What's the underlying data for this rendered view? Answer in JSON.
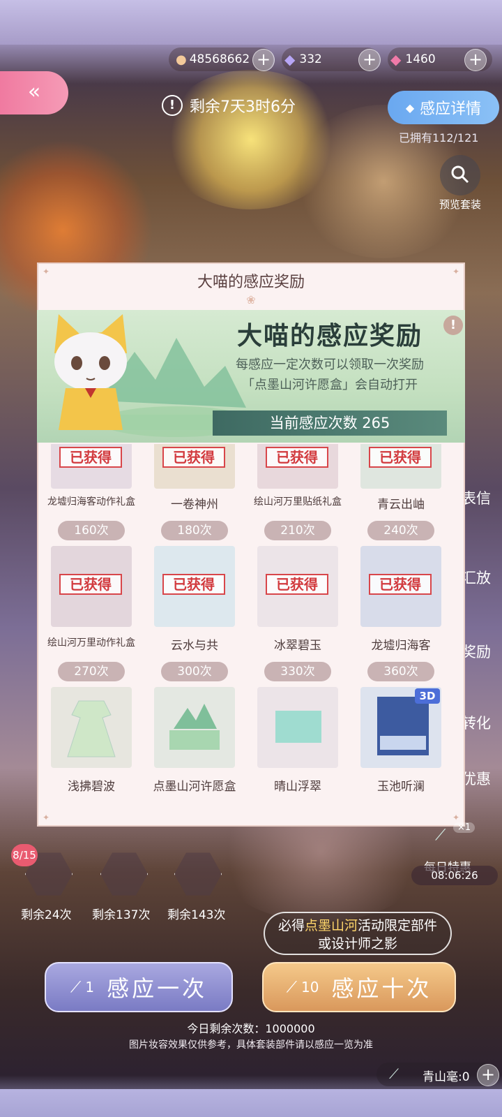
{
  "currency": {
    "coins": "48568662",
    "diamonds": "332",
    "pink_diamonds": "1460",
    "plus": "+"
  },
  "header": {
    "back_icon": "«",
    "timer_icon": "!",
    "timer": "剩余7天3时6分",
    "detail_button": "感应详情",
    "owned": "已拥有112/121",
    "preview_label": "预览套装"
  },
  "side_tabs": [
    "表信",
    "汇放",
    "奖励",
    "转化",
    "优惠"
  ],
  "modal": {
    "title": "大喵的感应奖励",
    "banner_title": "大喵的感应奖励",
    "banner_info": "!",
    "banner_desc_1": "每感应一定次数可以领取一次奖励",
    "banner_desc_2": "「点墨山河许愿盒」会自动打开",
    "banner_count": "当前感应次数 265",
    "obtained_label": "已获得",
    "rows": [
      {
        "items": [
          {
            "name": "龙墟归海客动作礼盒",
            "obtained": true
          },
          {
            "name": "一卷神州",
            "obtained": true
          },
          {
            "name": "绘山河万里贴纸礼盒",
            "obtained": true
          },
          {
            "name": "青云出岫",
            "obtained": true
          }
        ]
      },
      {
        "items": [
          {
            "count": "160次",
            "name": "绘山河万里动作礼盒",
            "obtained": true
          },
          {
            "count": "180次",
            "name": "云水与共",
            "obtained": true
          },
          {
            "count": "210次",
            "name": "冰翠碧玉",
            "obtained": true
          },
          {
            "count": "240次",
            "name": "龙墟归海客",
            "obtained": true
          }
        ]
      },
      {
        "items": [
          {
            "count": "270次",
            "name": "浅拂碧波",
            "obtained": false
          },
          {
            "count": "300次",
            "name": "点墨山河许愿盒",
            "obtained": false
          },
          {
            "count": "330次",
            "name": "晴山浮翠",
            "obtained": false
          },
          {
            "count": "360次",
            "name": "玉池听澜",
            "obtained": false,
            "tag": "3D"
          }
        ]
      }
    ]
  },
  "progress": {
    "badge": "8/15",
    "remaining": [
      "剩余24次",
      "剩余137次",
      "剩余143次"
    ]
  },
  "daily_deal": {
    "label": "每日特惠",
    "multiplier": "×1",
    "time": "08:06:26"
  },
  "guarantee": {
    "prefix": "必得",
    "highlight": "点墨山河",
    "suffix": "活动限定部件",
    "line2": "或设计师之影"
  },
  "actions": {
    "once_count": "1",
    "once_label": "感应一次",
    "ten_count": "10",
    "ten_label": "感应十次"
  },
  "footer": {
    "today_remaining": "今日剩余次数：1000000",
    "disclaimer": "图片妆容效果仅供参考，具体套装部件请以感应一览为准",
    "qingshan": "青山毫:0",
    "plus": "+"
  },
  "colors": {
    "obtained_red": "#d23a3e",
    "detail_blue": "#6aa8f0",
    "back_pink": "#f07aa0",
    "once_purple": "#7a7bc4",
    "ten_orange": "#d9985c"
  }
}
